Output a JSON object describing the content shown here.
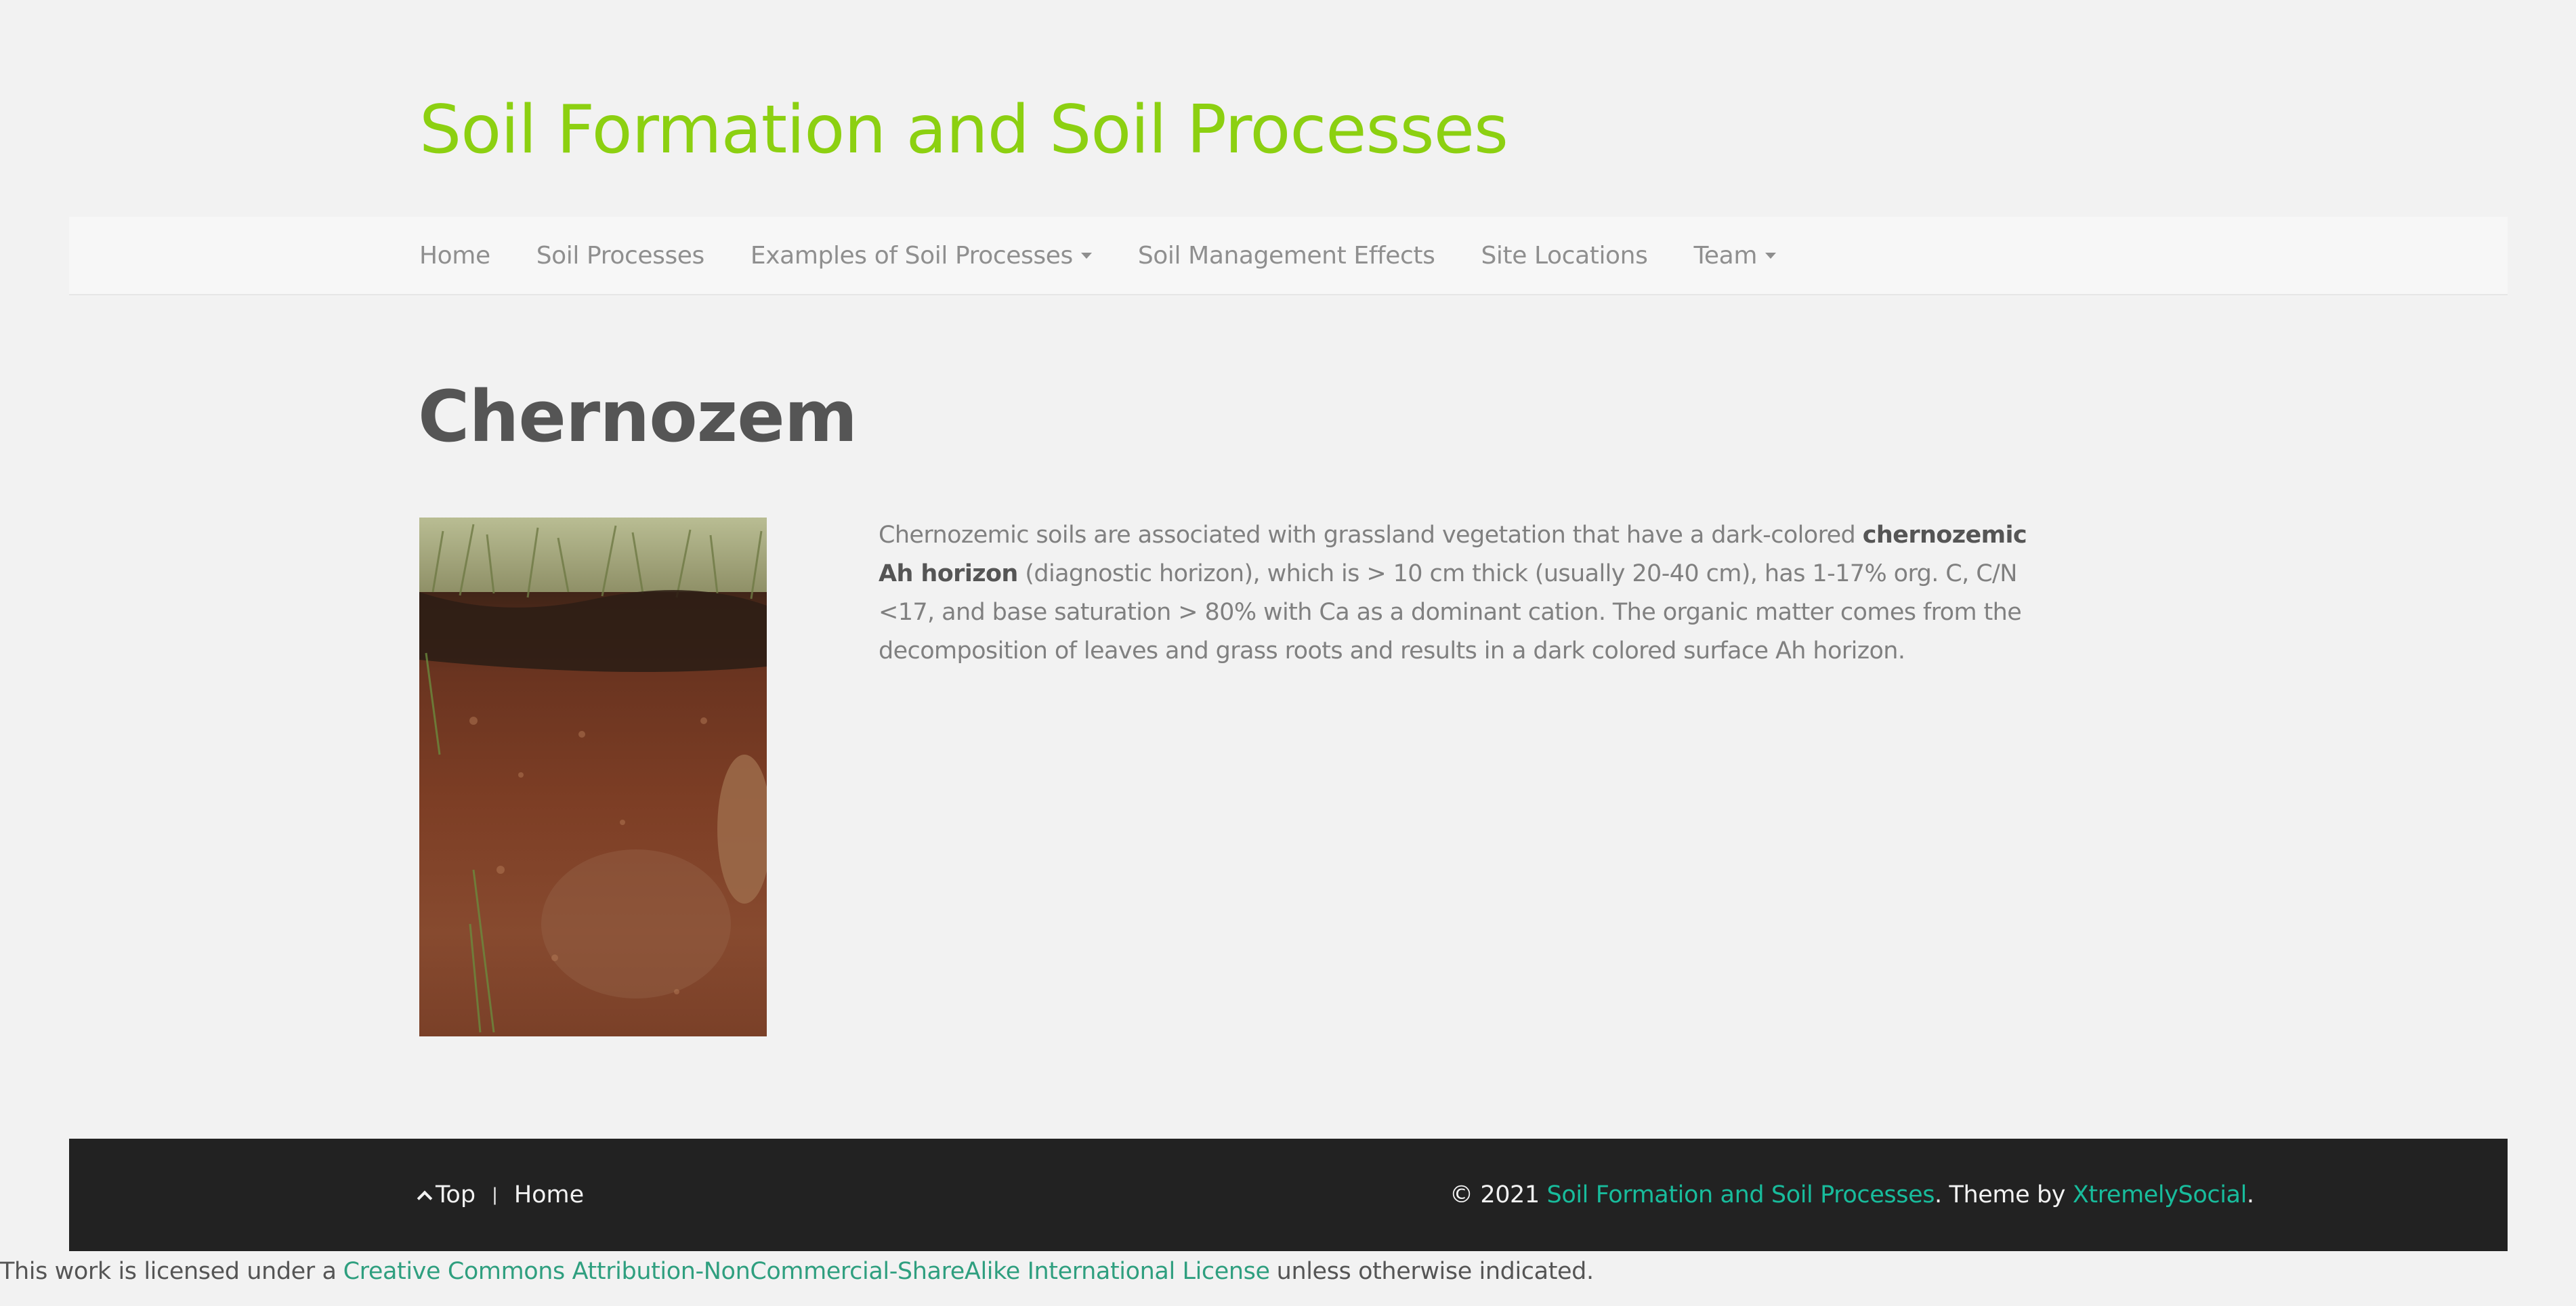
{
  "header": {
    "site_title": "Soil Formation and Soil Processes"
  },
  "nav": {
    "items": [
      {
        "label": "Home"
      },
      {
        "label": "Soil Processes"
      },
      {
        "label": "Examples of Soil Processes"
      },
      {
        "label": "Soil Management Effects"
      },
      {
        "label": "Site Locations"
      },
      {
        "label": "Team"
      }
    ]
  },
  "main": {
    "title": "Chernozem",
    "image_subject": "chernozem soil profile photo",
    "paragraph": {
      "part1": "Chernozemic soils are associated with grassland vegetation that have a dark-colored ",
      "bold": "chernozemic Ah horizon",
      "part2": " (diagnostic horizon), which is > 10 cm thick (usually 20-40 cm), has 1-17% org. C, C/N <17, and base saturation > 80% with Ca as a dominant cation. The organic matter comes from the decomposition of leaves and grass roots and results in a dark colored surface Ah horizon."
    }
  },
  "footer": {
    "top_label": "Top",
    "separator": "|",
    "home_label": "Home",
    "copyright_prefix": "© 2021 ",
    "site_link": "Soil Formation and Soil Processes",
    "theme_text": ". Theme by ",
    "theme_link": "XtremelySocial",
    "end_period": "."
  },
  "license": {
    "prefix": "This work is licensed under a",
    "link": "Creative Commons Attribution-NonCommercial-ShareAlike International License",
    "suffix": "unless otherwise indicated."
  },
  "colors": {
    "brand_green": "#8cd011",
    "link_teal": "#18bc9c",
    "footer_bg": "#222222",
    "page_bg": "#f2f2f2"
  }
}
